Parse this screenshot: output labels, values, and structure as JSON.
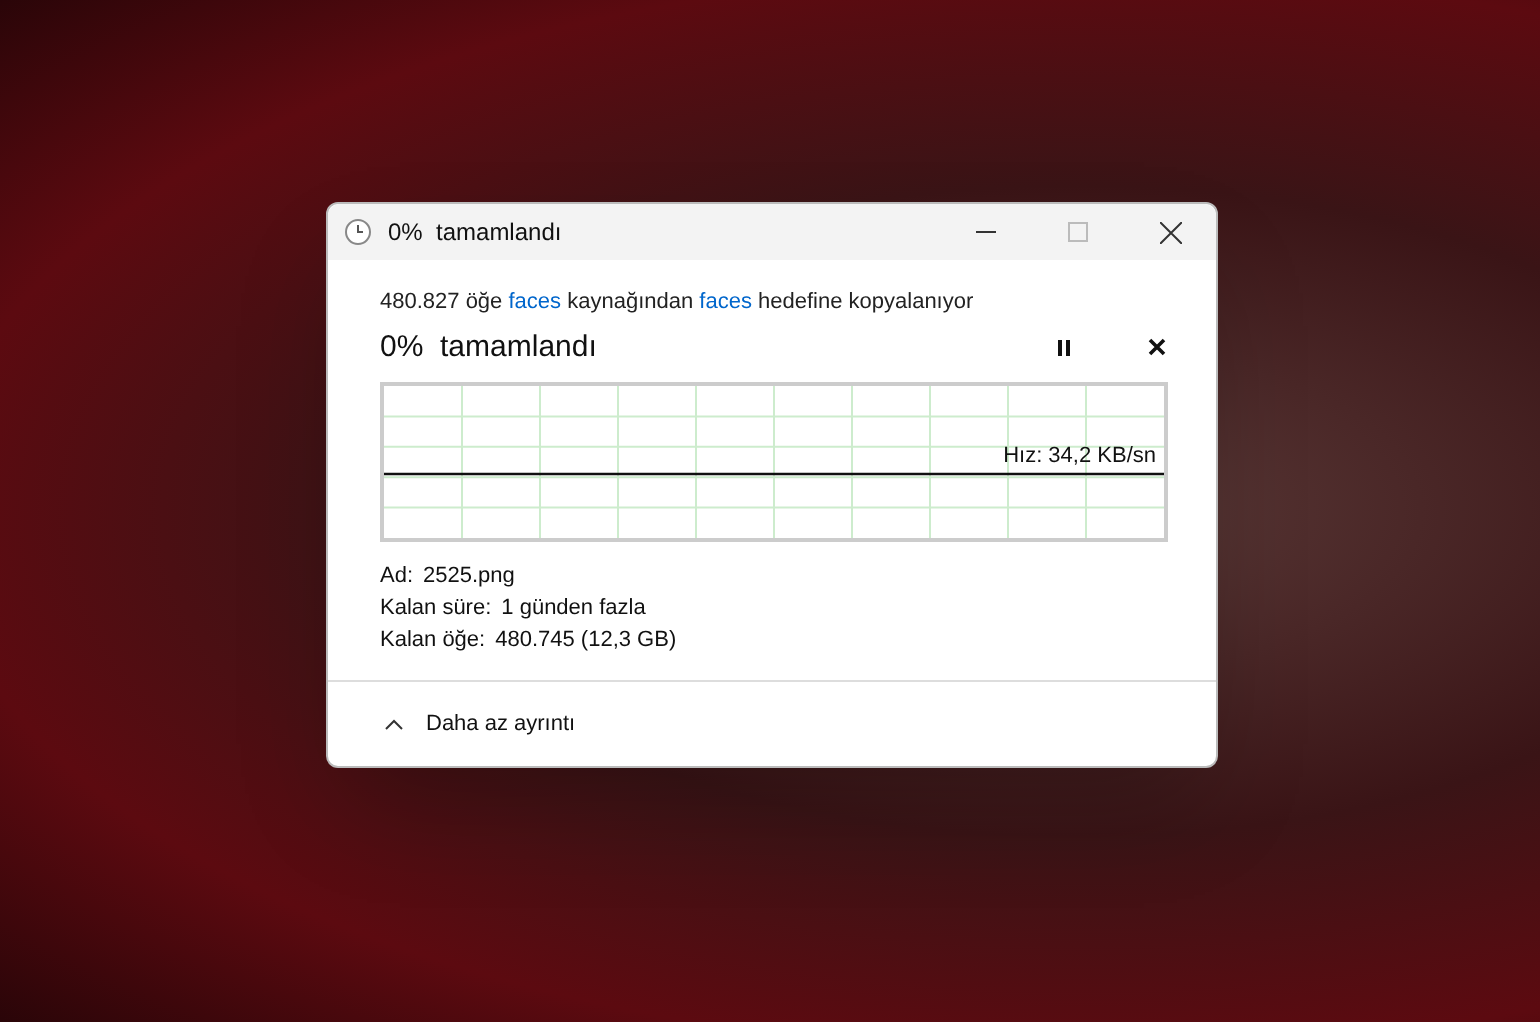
{
  "window": {
    "title": "0%  tamamlandı"
  },
  "description": [
    {
      "kind": "text",
      "text": "480.827 öğe"
    },
    {
      "kind": "link",
      "text": "faces"
    },
    {
      "kind": "text",
      "text": "kaynağından"
    },
    {
      "kind": "link",
      "text": "faces"
    },
    {
      "kind": "text",
      "text": "hedefine kopyalanıyor"
    }
  ],
  "progress_heading": "0%  tamamlandı",
  "speed": "Hız: 34,2 KB/sn",
  "details": [
    {
      "label": "Ad:",
      "value": "2525.png"
    },
    {
      "label": "Kalan süre:",
      "value": "1 günden fazla"
    },
    {
      "label": "Kalan öğe:",
      "value": "480.745 (12,3 GB)"
    }
  ],
  "toggle_details": {
    "label": "Daha az ayrıntı",
    "expanded": true
  }
}
